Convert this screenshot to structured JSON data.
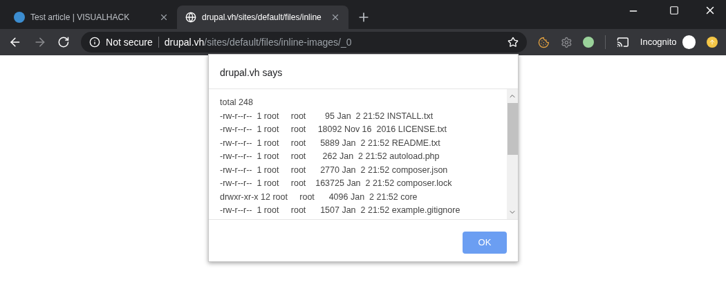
{
  "tabs": [
    {
      "title": "Test article | VISUALHACK",
      "selected": false
    },
    {
      "title": "drupal.vh/sites/default/files/inline",
      "selected": true
    }
  ],
  "toolbar": {
    "security": "Not secure",
    "url_host": "drupal.vh",
    "url_path": "/sites/default/files/inline-images/_0",
    "profile": "Incognito"
  },
  "dialog": {
    "title": "drupal.vh says",
    "lines": [
      "total 248",
      "-rw-r--r--  1 root     root        95 Jan  2 21:52 INSTALL.txt",
      "-rw-r--r--  1 root     root     18092 Nov 16  2016 LICENSE.txt",
      "-rw-r--r--  1 root     root      5889 Jan  2 21:52 README.txt",
      "-rw-r--r--  1 root     root       262 Jan  2 21:52 autoload.php",
      "-rw-r--r--  1 root     root      2770 Jan  2 21:52 composer.json",
      "-rw-r--r--  1 root     root    163725 Jan  2 21:52 composer.lock",
      "drwxr-xr-x 12 root     root      4096 Jan  2 21:52 core",
      "-rw-r--r--  1 root     root      1507 Jan  2 21:52 example.gitignore"
    ],
    "button": "OK"
  }
}
